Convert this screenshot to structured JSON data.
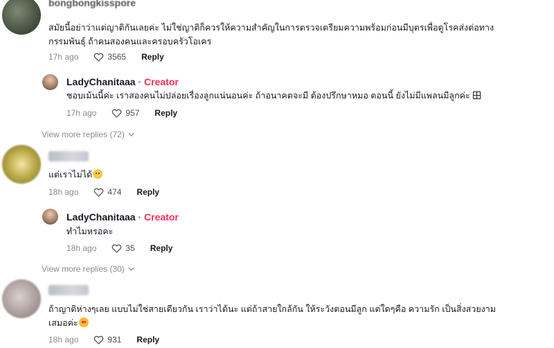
{
  "comments": [
    {
      "username": "bongbongkisspore",
      "text_line1": "สมัยนี้อย่าว่าแต่ญาติกันเลยค่ะ ไม่ใช่ญาติก็ควรให้ความสำคัญในการตรวจเตรียมความพร้อมก่อนมีบุตรเพื่อดูโรคส่งต่อทาง",
      "text_line2": "กรรมพันธุ์ ถ้าคนสองคนและครอบครัวโอเคร",
      "time": "17h ago",
      "likes": "3565",
      "reply_label": "Reply"
    },
    {
      "username": "LadyChanitaaa",
      "badge": " · Creator",
      "text": "ชอบเม้นนี้ค่ะ เราสองคนไม่ปล่อยเรื่องลูกแน่นอนค่ะ ถ้าอนาคตจะมี ต้องปรึกษาหมอ ตอนนี้ ยังไม่มีแพลนมีลูกค่ะ",
      "time": "17h ago",
      "likes": "957",
      "reply_label": "Reply"
    },
    {
      "view_more": "View more replies (72)"
    },
    {
      "text": "แต่เราไม่ได้",
      "time": "18h ago",
      "likes": "474",
      "reply_label": "Reply"
    },
    {
      "username": "LadyChanitaaa",
      "badge": " · Creator",
      "text": "ทำไมหรอคะ",
      "time": "18h ago",
      "likes": "35",
      "reply_label": "Reply"
    },
    {
      "view_more": "View more replies (30)"
    },
    {
      "text_line1": "ถ้าญาติห่างๆเลย แบบไม่ใช่สายเดียวกัน เราว่าได้นะ แต่ถ้าสายใกล้กัน ให้ระวังตอนมีลูก แต่ใดๆคือ ความรัก เป็นสิ่งสวยงาม",
      "text_line2": "เสมอค่ะ",
      "time": "18h ago",
      "likes": "931",
      "reply_label": "Reply"
    }
  ],
  "colors": {
    "creator": "#fe2c55",
    "meta": "#8a8b91",
    "text": "#161823"
  },
  "icons": [
    "heart-outline-icon",
    "chevron-down-icon"
  ]
}
